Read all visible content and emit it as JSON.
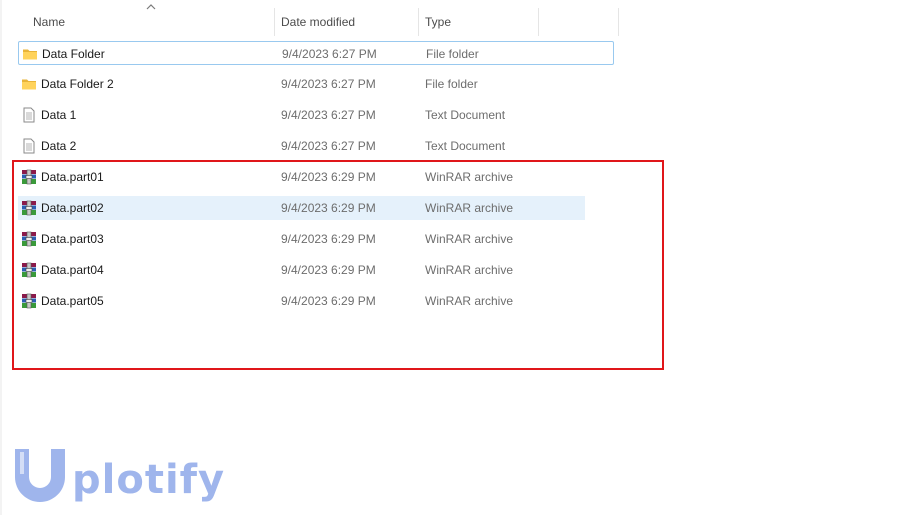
{
  "columns": {
    "name": "Name",
    "date_modified": "Date modified",
    "type": "Type"
  },
  "files": [
    {
      "name": "Data Folder",
      "date": "9/4/2023 6:27 PM",
      "type": "File folder",
      "icon": "folder-icon"
    },
    {
      "name": "Data Folder 2",
      "date": "9/4/2023 6:27 PM",
      "type": "File folder",
      "icon": "folder-icon"
    },
    {
      "name": "Data 1",
      "date": "9/4/2023 6:27 PM",
      "type": "Text Document",
      "icon": "text-document-icon"
    },
    {
      "name": "Data 2",
      "date": "9/4/2023 6:27 PM",
      "type": "Text Document",
      "icon": "text-document-icon"
    },
    {
      "name": "Data.part01",
      "date": "9/4/2023 6:29 PM",
      "type": "WinRAR archive",
      "icon": "winrar-archive-icon"
    },
    {
      "name": "Data.part02",
      "date": "9/4/2023 6:29 PM",
      "type": "WinRAR archive",
      "icon": "winrar-archive-icon"
    },
    {
      "name": "Data.part03",
      "date": "9/4/2023 6:29 PM",
      "type": "WinRAR archive",
      "icon": "winrar-archive-icon"
    },
    {
      "name": "Data.part04",
      "date": "9/4/2023 6:29 PM",
      "type": "WinRAR archive",
      "icon": "winrar-archive-icon"
    },
    {
      "name": "Data.part05",
      "date": "9/4/2023 6:29 PM",
      "type": "WinRAR archive",
      "icon": "winrar-archive-icon"
    }
  ],
  "state": {
    "focused_row": "Data Folder",
    "hovered_row": "Data.part02",
    "sort_column": "Name"
  },
  "annotation": {
    "highlight_color": "#e0161a"
  },
  "watermark": {
    "logo_text": "plotify",
    "color": "#9fb5ec"
  }
}
